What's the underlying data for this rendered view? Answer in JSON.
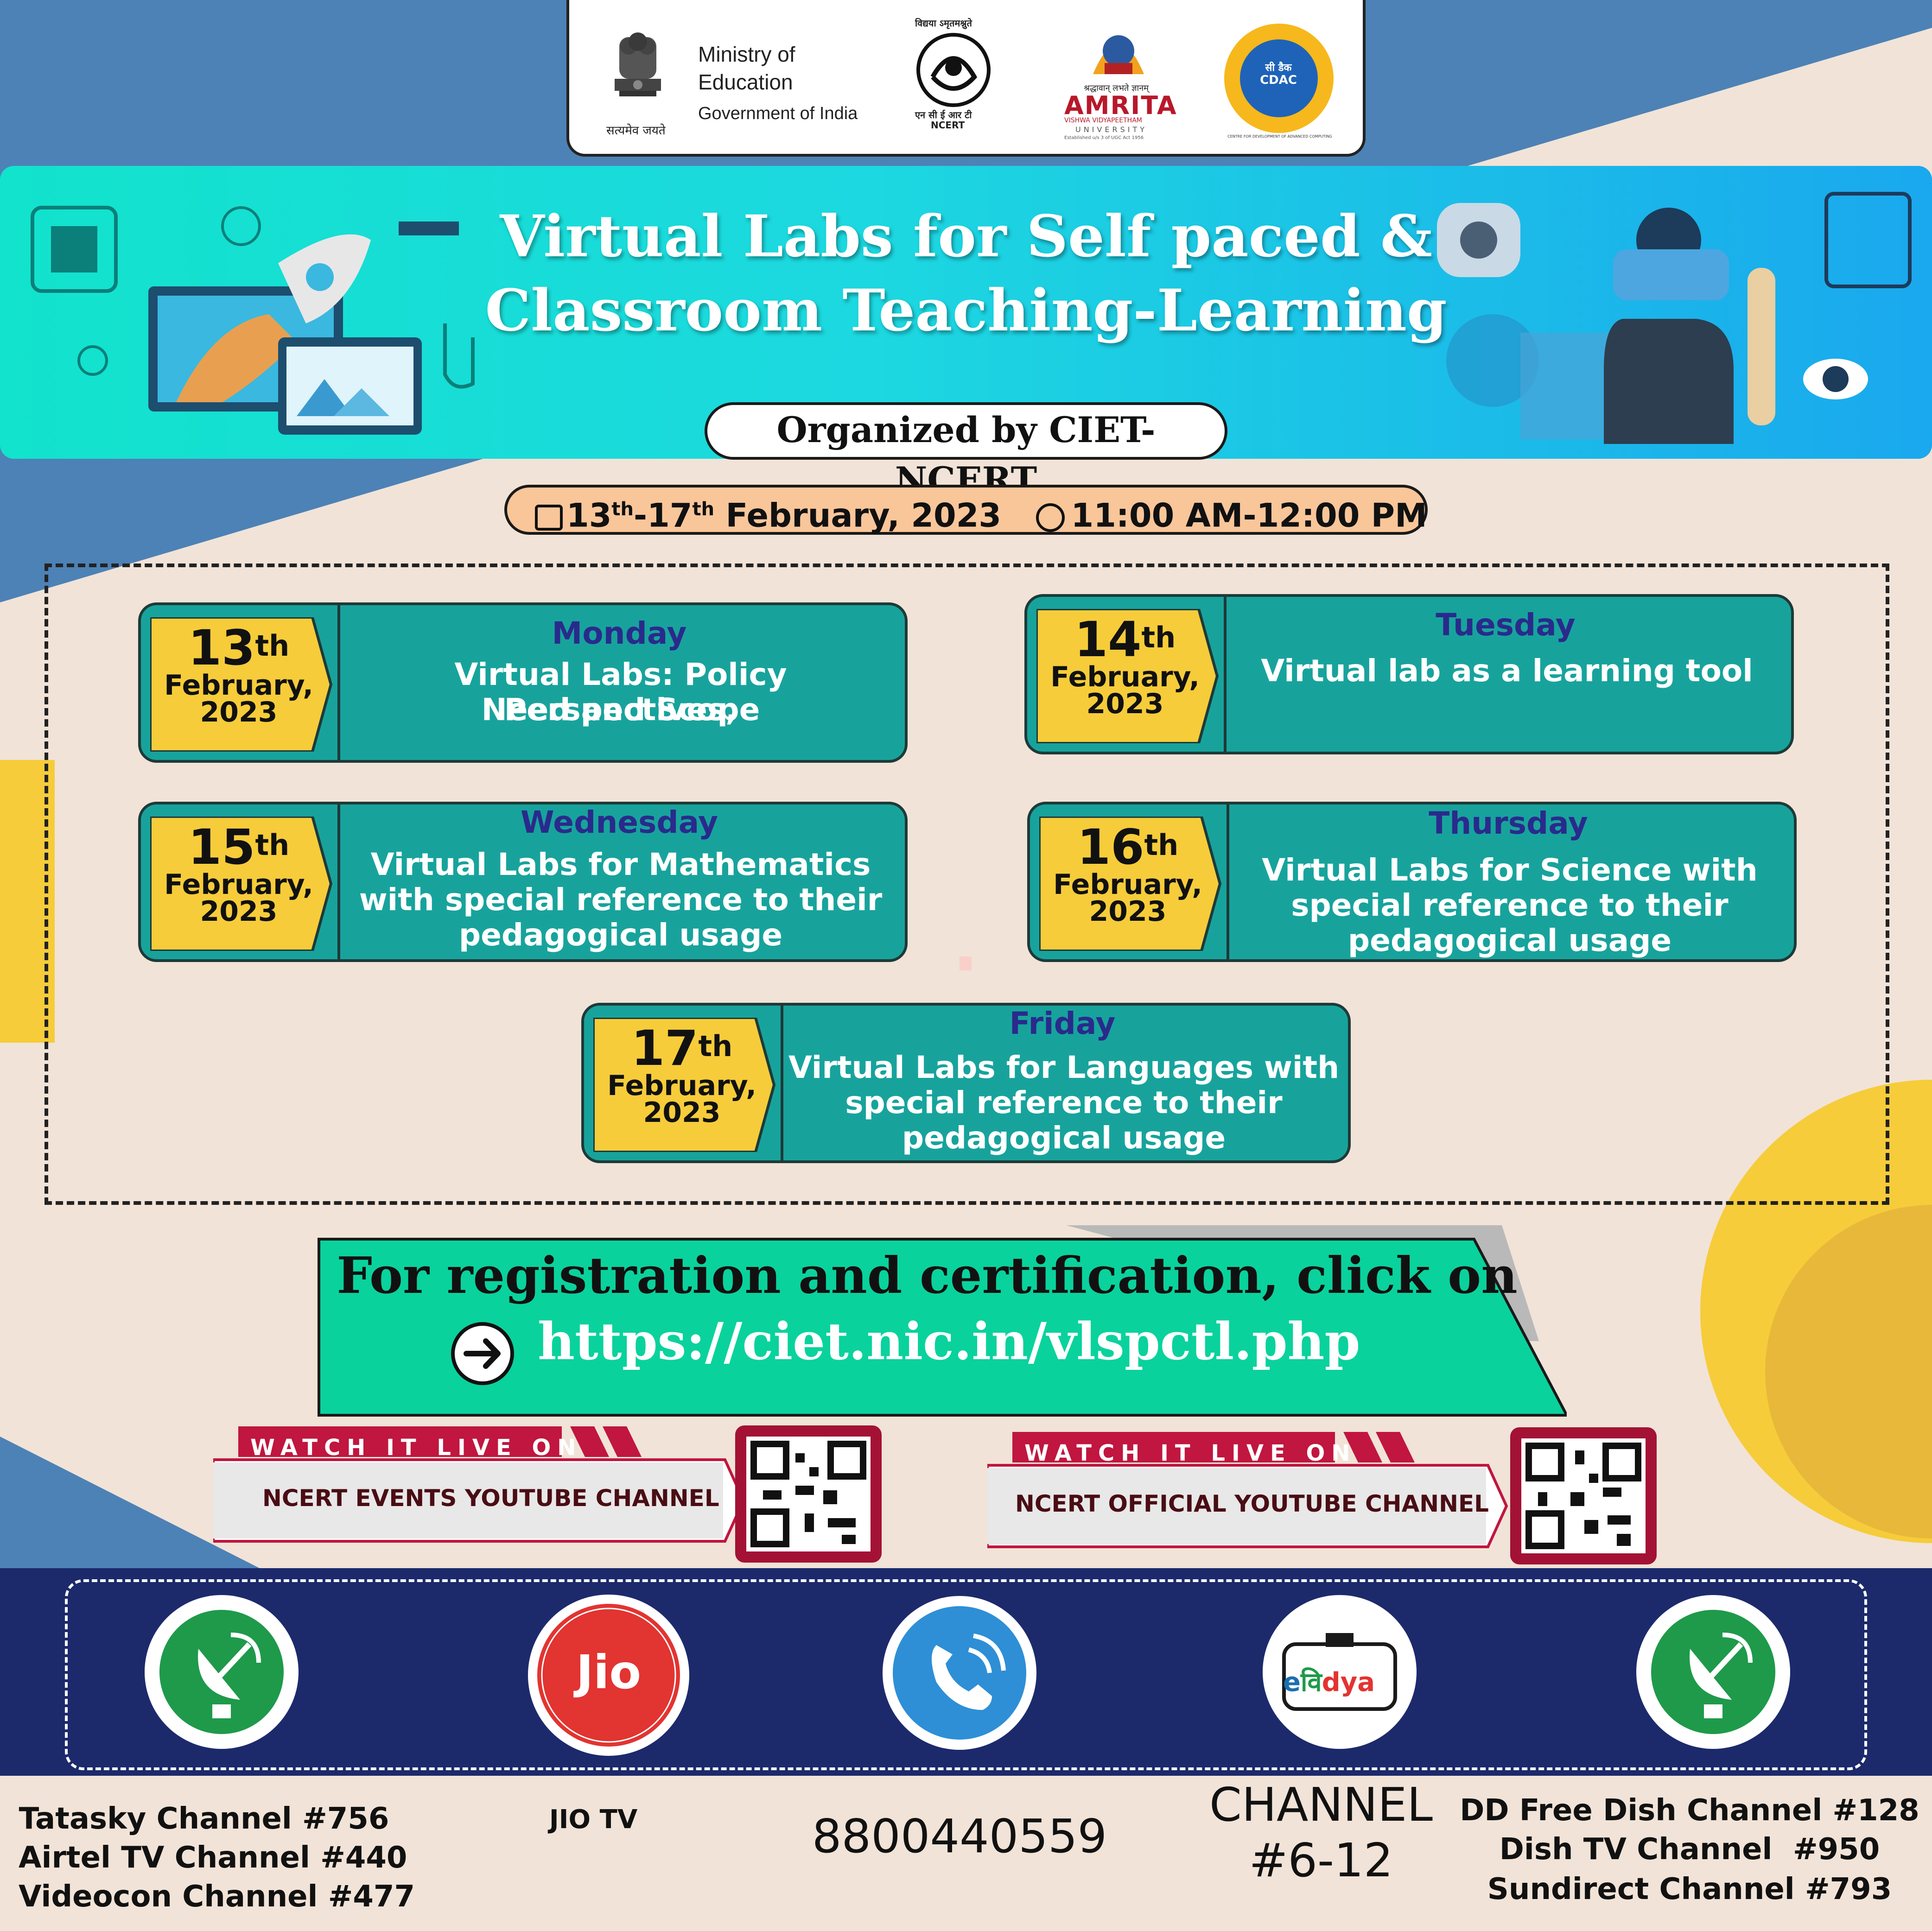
{
  "logos": {
    "ministry": {
      "line1": "Ministry of",
      "line2": "Education",
      "line3": "Government of India",
      "motto": "सत्यमेव जयते"
    },
    "ncert": {
      "top": "विद्यया ऽमृतमश्नुते",
      "bottom": "एन सी ई आर टी",
      "name": "NCERT"
    },
    "amrita": {
      "tagline": "श्रद्धावान् लभते ज्ञानम्",
      "name": "AMRITA",
      "sub": "VISHWA VIDYAPEETHAM",
      "uni": "UNIVERSITY",
      "est": "Established u/s 3 of UGC Act 1956"
    },
    "cdac": {
      "name": "सी डैक",
      "short": "CDAC",
      "ring": "CENTRE FOR DEVELOPMENT OF ADVANCED COMPUTING"
    }
  },
  "banner": {
    "title_line1": "Virtual Labs for Self paced &",
    "title_line2": "Classroom Teaching-Learning",
    "organized_by": "Organized by CIET-NCERT"
  },
  "schedule": {
    "date_start": "13",
    "date_start_sup": "th",
    "date_dash": "-17",
    "date_end_sup": "th",
    "date_rest": " February, 2023",
    "time": "11:00 AM-12:00 PM"
  },
  "sessions": [
    {
      "day": "13",
      "sup": "th",
      "month": "February,",
      "year": "2023",
      "weekday": "Monday",
      "topic": [
        "Virtual Labs: Policy Perspectives,",
        "Need and Scope"
      ]
    },
    {
      "day": "14",
      "sup": "th",
      "month": "February,",
      "year": "2023",
      "weekday": "Tuesday",
      "topic": [
        "Virtual lab as a learning tool"
      ]
    },
    {
      "day": "15",
      "sup": "th",
      "month": "February,",
      "year": "2023",
      "weekday": "Wednesday",
      "topic": [
        "Virtual Labs for Mathematics",
        "with special reference to their",
        "pedagogical usage"
      ]
    },
    {
      "day": "16",
      "sup": "th",
      "month": "February,",
      "year": "2023",
      "weekday": "Thursday",
      "topic": [
        "Virtual Labs for Science with",
        "special reference to their",
        "pedagogical usage"
      ]
    },
    {
      "day": "17",
      "sup": "th",
      "month": "February,",
      "year": "2023",
      "weekday": "Friday",
      "topic": [
        "Virtual Labs for Languages with",
        "special reference to their",
        "pedagogical usage"
      ]
    }
  ],
  "registration": {
    "text": "For registration and certification, click on",
    "url": "https://ciet.nic.in/vlspctl.php"
  },
  "live": [
    {
      "label": "WATCH IT LIVE ON",
      "channel": "NCERT EVENTS YOUTUBE CHANNEL"
    },
    {
      "label": "WATCH IT LIVE ON",
      "channel": "NCERT OFFICIAL YOUTUBE CHANNEL"
    }
  ],
  "platforms": {
    "jio_logo": "Jio",
    "evidya_logo": "e",
    "evidya_logo2": "वि",
    "evidya_logo3": "dya",
    "tatasky": "Tatasky Channel #756",
    "airtel": "Airtel TV Channel #440",
    "videocon": "Videocon Channel #477",
    "jiotv": "JIO TV",
    "phone": "8800440559",
    "channel": "CHANNEL",
    "channel_range": "#6-12",
    "ddfree": "DD Free Dish Channel #128",
    "dishtv": "Dish TV Channel  #950",
    "sundirect": "Sundirect Channel #793"
  },
  "colors": {
    "teal": "#17a39c",
    "yellow": "#f6cc3a",
    "navy": "#1c2a6c",
    "blue_bg": "#4d82b6",
    "green_reg": "#0ad29c",
    "crimson": "#c0163f"
  }
}
